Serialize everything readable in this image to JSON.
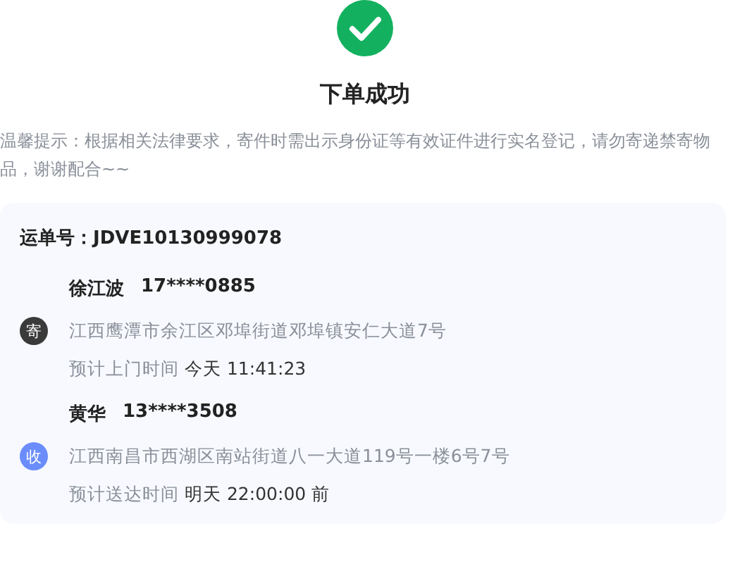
{
  "title": "下单成功",
  "notice": "温馨提示：根据相关法律要求，寄件时需出示身份证等有效证件进行实名登记，请勿寄递禁寄物品，谢谢配合~~",
  "waybill": {
    "label": "运单号：",
    "number": "JDVE10130999078"
  },
  "parties": [
    {
      "kind": "sender",
      "badge": "寄",
      "name": "徐江波",
      "phone": "17****0885",
      "address": "江西鹰潭市余江区邓埠街道邓埠镇安仁大道7号",
      "time_label": "预计上门时间",
      "time_value": "今天 11:41:23"
    },
    {
      "kind": "receiver",
      "badge": "收",
      "name": "黄华",
      "phone": "13****3508",
      "address": "江西南昌市西湖区南站街道八一大道119号一楼6号7号",
      "time_label": "预计送达时间",
      "time_value": "明天 22:00:00 前"
    }
  ]
}
